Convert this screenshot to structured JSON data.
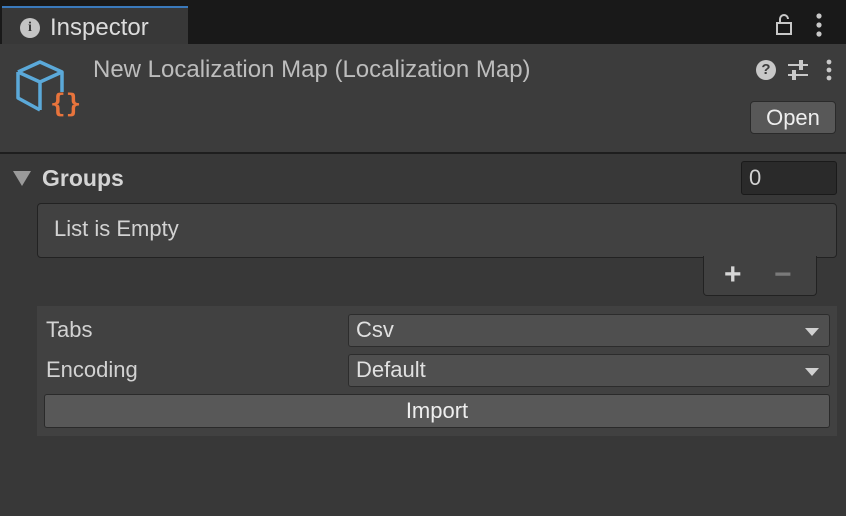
{
  "tab": {
    "title": "Inspector",
    "info_icon": "info-icon",
    "lock_icon": "lock-icon",
    "menu_icon": "vertical-ellipsis-icon"
  },
  "header": {
    "asset_icon": "localization-map-icon",
    "title": "New Localization Map (Localization Map)",
    "help_icon": "help-icon",
    "presets_icon": "presets-icon",
    "context_icon": "vertical-ellipsis-icon",
    "open_label": "Open"
  },
  "groups": {
    "label": "Groups",
    "size": "0",
    "empty_text": "List is Empty",
    "add_label": "+",
    "remove_label": "−"
  },
  "import": {
    "tabs_label": "Tabs",
    "tabs_value": "Csv",
    "encoding_label": "Encoding",
    "encoding_value": "Default",
    "import_label": "Import"
  },
  "colors": {
    "accent": "#3a79bb",
    "icon_blue": "#5ba9d9",
    "icon_orange": "#e8743c",
    "background": "#383838"
  }
}
